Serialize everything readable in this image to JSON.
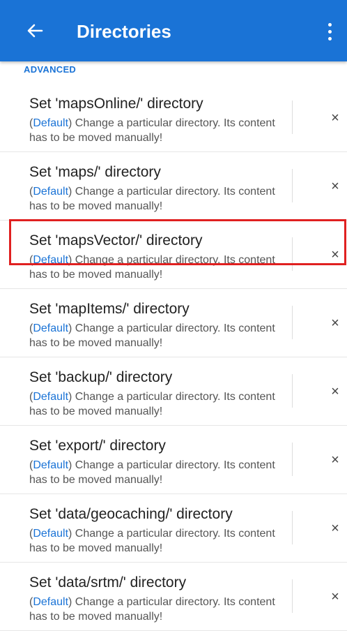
{
  "appbar": {
    "title": "Directories",
    "back_icon": "arrow-back-icon",
    "menu_icon": "more-vert-icon",
    "color": "#1a73d6"
  },
  "section_label": "ADVANCED",
  "items": [
    {
      "title": "Set 'mapsOnline/' directory",
      "default": "Default",
      "desc_mid": ") Change a particular directory. Its content has to be moved manually!"
    },
    {
      "title": "Set 'maps/' directory",
      "default": "Default",
      "desc_mid": ") Change a particular directory. Its content has to be moved manually!"
    },
    {
      "title": "Set 'mapsVector/' directory",
      "default": "Default",
      "desc_mid": ") Change a particular directory. Its content has to be moved manually!"
    },
    {
      "title": "Set 'mapItems/' directory",
      "default": "Default",
      "desc_mid": ") Change a particular directory. Its content has to be moved manually!"
    },
    {
      "title": "Set 'backup/' directory",
      "default": "Default",
      "desc_mid": ") Change a particular directory. Its content has to be moved manually!"
    },
    {
      "title": "Set 'export/' directory",
      "default": "Default",
      "desc_mid": ") Change a particular directory. Its content has to be moved manually!"
    },
    {
      "title": "Set 'data/geocaching/' directory",
      "default": "Default",
      "desc_mid": ") Change a particular directory. Its content has to be moved manually!"
    },
    {
      "title": "Set 'data/srtm/' directory",
      "default": "Default",
      "desc_mid": ") Change a particular directory. Its content has to be moved manually!"
    }
  ],
  "clear_glyph": "×",
  "paren_open": "(",
  "highlight_color": "#e02020"
}
